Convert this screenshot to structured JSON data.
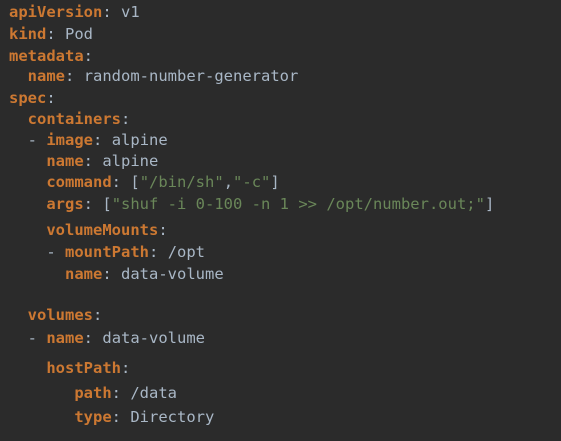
{
  "editor": {
    "background": "#2b2b2b",
    "syntax_colors": {
      "key": "#cc7832",
      "value": "#a9b7c6",
      "string": "#6a8759"
    },
    "lines": [
      {
        "id": "apiversion",
        "indent": "",
        "dash": "",
        "key": "apiVersion",
        "value": "v1"
      },
      {
        "id": "kind",
        "indent": "",
        "dash": "",
        "key": "kind",
        "value": "Pod"
      },
      {
        "id": "metadata",
        "indent": "",
        "dash": "",
        "key": "metadata",
        "value": ""
      },
      {
        "id": "metadata-name",
        "indent": "  ",
        "dash": "",
        "key": "name",
        "value": "random-number-generator"
      },
      {
        "id": "spec",
        "indent": "",
        "dash": "",
        "key": "spec",
        "value": ""
      },
      {
        "id": "containers",
        "indent": "  ",
        "dash": "",
        "key": "containers",
        "value": ""
      },
      {
        "id": "container-image",
        "indent": "  ",
        "dash": "- ",
        "key": "image",
        "value": "alpine"
      },
      {
        "id": "container-name",
        "indent": "    ",
        "dash": "",
        "key": "name",
        "value": "alpine"
      },
      {
        "id": "container-command",
        "indent": "    ",
        "dash": "",
        "key": "command",
        "array": [
          "\"/bin/sh\"",
          "\"-c\""
        ]
      },
      {
        "id": "container-args",
        "indent": "    ",
        "dash": "",
        "key": "args",
        "array": [
          "\"shuf -i 0-100 -n 1 >> /opt/number.out;\""
        ]
      },
      {
        "id": "volumemounts",
        "indent": "    ",
        "dash": "",
        "key": "volumeMounts",
        "value": ""
      },
      {
        "id": "mountpath",
        "indent": "    ",
        "dash": "- ",
        "key": "mountPath",
        "value": "/opt"
      },
      {
        "id": "mount-name",
        "indent": "      ",
        "dash": "",
        "key": "name",
        "value": "data-volume"
      },
      {
        "id": "volumes",
        "indent": "  ",
        "dash": "",
        "key": "volumes",
        "value": ""
      },
      {
        "id": "volume-name",
        "indent": "  ",
        "dash": "- ",
        "key": "name",
        "value": "data-volume"
      },
      {
        "id": "hostpath",
        "indent": "    ",
        "dash": "",
        "key": "hostPath",
        "value": ""
      },
      {
        "id": "hostpath-path",
        "indent": "       ",
        "dash": "",
        "key": "path",
        "value": "/data"
      },
      {
        "id": "hostpath-type",
        "indent": "       ",
        "dash": "",
        "key": "type",
        "value": "Directory"
      }
    ]
  }
}
